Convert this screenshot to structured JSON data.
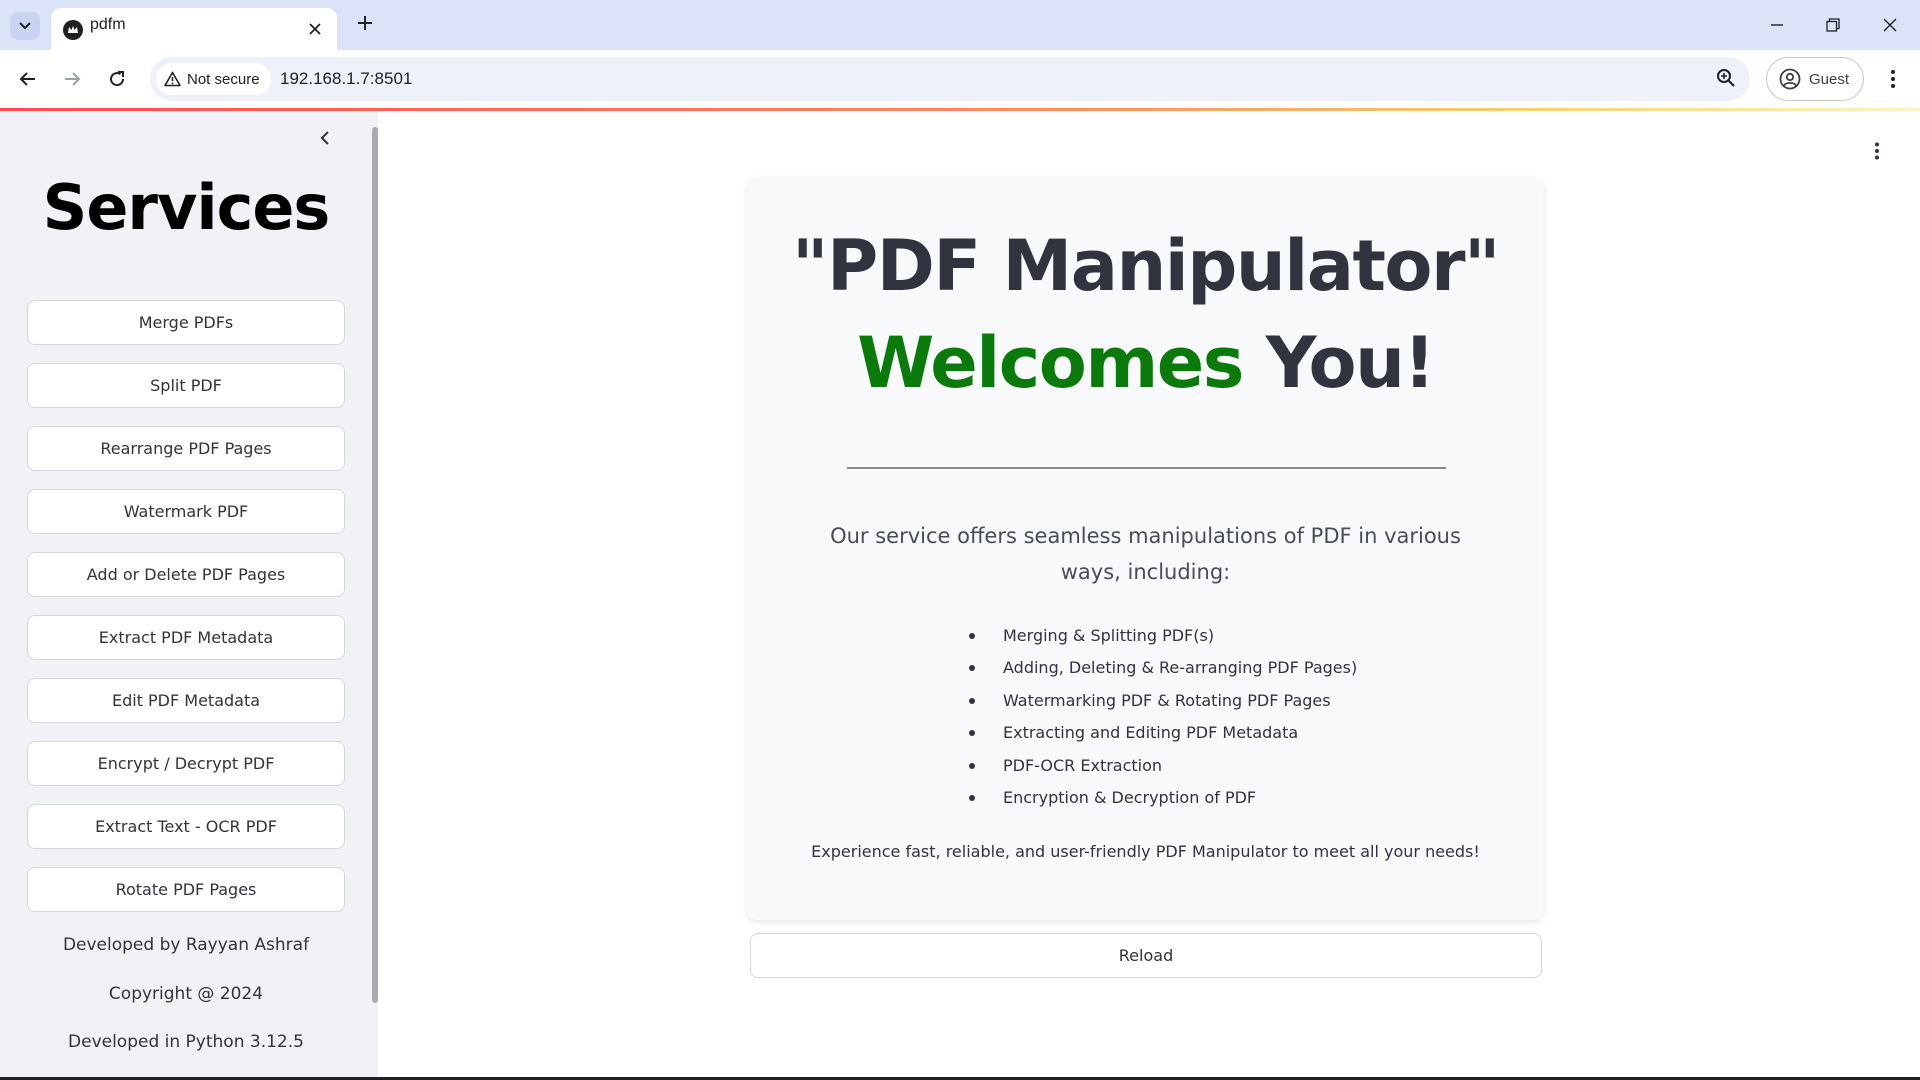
{
  "browser": {
    "tab": {
      "title": "pdfm"
    },
    "address": {
      "security_label": "Not secure",
      "url": "192.168.1.7:8501"
    },
    "profile": {
      "label": "Guest"
    },
    "icons": [
      "tab-search-icon",
      "favicon-icon",
      "close-icon",
      "plus-icon",
      "minimize-icon",
      "restore-icon",
      "close-window-icon",
      "back-icon",
      "forward-icon",
      "reload-icon",
      "warning-icon",
      "zoom-icon",
      "account-icon",
      "more-vert-icon"
    ]
  },
  "sidebar": {
    "title": "Services",
    "services": [
      {
        "label": "Merge PDFs"
      },
      {
        "label": "Split PDF"
      },
      {
        "label": "Rearrange PDF Pages"
      },
      {
        "label": "Watermark PDF"
      },
      {
        "label": "Add or Delete PDF Pages"
      },
      {
        "label": "Extract PDF Metadata"
      },
      {
        "label": "Edit PDF Metadata"
      },
      {
        "label": "Encrypt / Decrypt PDF"
      },
      {
        "label": "Extract Text - OCR PDF"
      },
      {
        "label": "Rotate PDF Pages"
      }
    ],
    "footer": {
      "developer": "Developed by Rayyan Ashraf",
      "copyright": "Copyright @ 2024",
      "python": "Developed in Python 3.12.5"
    }
  },
  "main": {
    "hero": {
      "line1": "\"PDF Manipulator\"",
      "welcome": "Welcomes",
      "you": "You!"
    },
    "intro": "Our service offers seamless manipulations of PDF in various ways, including:",
    "features": [
      "Merging & Splitting PDF(s)",
      "Adding, Deleting & Re-arranging PDF Pages)",
      "Watermarking PDF & Rotating PDF Pages",
      "Extracting and Editing PDF Metadata",
      "PDF-OCR Extraction",
      "Encryption & Decryption of PDF"
    ],
    "tagline": "Experience fast, reliable, and user-friendly PDF Manipulator to meet all your needs!",
    "reload_label": "Reload"
  },
  "colors": {
    "accent_green": "#0a7a0a",
    "sidebar_bg": "#f0f2f6",
    "text": "#31333f",
    "chrome_tabstrip": "#dae3f8"
  }
}
